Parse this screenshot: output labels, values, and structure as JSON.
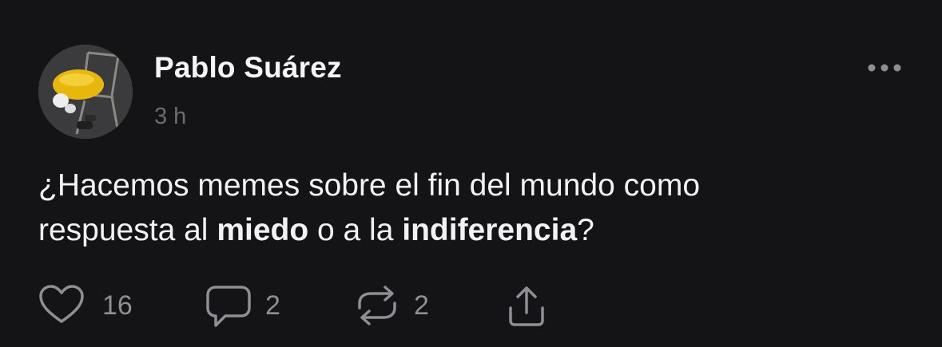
{
  "post": {
    "author": "Pablo Suárez",
    "time": "3 h",
    "text": {
      "line1": "¿Hacemos memes sobre el fin del mundo como",
      "line2_prefix": "respuesta al ",
      "bold1": "miedo",
      "mid": " o a la ",
      "bold2": "indiferencia",
      "suffix": "?"
    }
  },
  "actions": {
    "like": {
      "icon": "heart-icon",
      "count": "16"
    },
    "reply": {
      "icon": "comment-icon",
      "count": "2"
    },
    "repost": {
      "icon": "repost-icon",
      "count": "2"
    },
    "share": {
      "icon": "share-icon"
    }
  },
  "more": {
    "icon": "more-icon"
  },
  "colors": {
    "background": "#141416",
    "text": "#f2f2f2",
    "muted": "#8e8e93"
  }
}
